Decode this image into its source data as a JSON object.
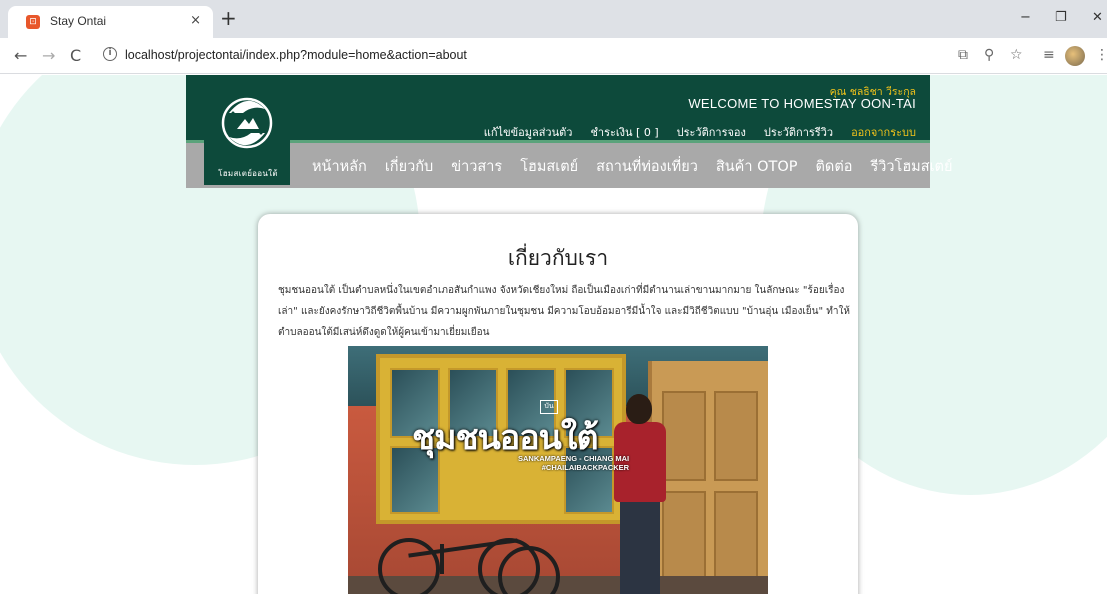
{
  "browser": {
    "tab_title": "Stay Ontai",
    "tab_close": "×",
    "new_tab": "+",
    "url": "localhost/projectontai/index.php?module=home&action=about",
    "window_minimize": "−",
    "window_restore": "❐",
    "window_close": "✕"
  },
  "header": {
    "logo_text": "โฮมสเตย์ออนใต้",
    "user_name": "คุณ ชลธิชา วีระกุล",
    "welcome": "WELCOME TO HOMESTAY OON-TAI",
    "user_links": [
      {
        "label": "แก้ไขข้อมูลส่วนตัว"
      },
      {
        "label": "ชำระเงิน [ 0 ]"
      },
      {
        "label": "ประวัติการจอง"
      },
      {
        "label": "ประวัติการรีวิว"
      },
      {
        "label": "ออกจากระบบ"
      }
    ],
    "nav": [
      {
        "label": "หน้าหลัก"
      },
      {
        "label": "เกี่ยวกับ"
      },
      {
        "label": "ข่าวสาร"
      },
      {
        "label": "โฮมสเตย์"
      },
      {
        "label": "สถานที่ท่องเที่ยว"
      },
      {
        "label": "สินค้า OTOP"
      },
      {
        "label": "ติดต่อ"
      },
      {
        "label": "รีวิวโฮมสเตย์"
      }
    ]
  },
  "content": {
    "title": "เกี่ยวกับเรา",
    "body": "ชุมชนออนใต้ เป็นตำบลหนึ่งในเขตอำเภอสันกำแพง จังหวัดเชียงใหม่ ถือเป็นเมืองเก่าที่มีตำนานเล่าขานมากมาย ในลักษณะ \"ร้อยเรื่องเล่า\" และยังคงรักษาวิถีชีวิตพื้นบ้าน มีความผูกพันภายในชุมชน มีความโอบอ้อมอารีมีน้ำใจ และมีวิถีชีวิตแบบ \"บ้านอุ่น เมืองเย็น\" ทำให้ตำบลออนใต้มีเสน่ห์ดึงดูดให้ผู้คนเข้ามาเยี่ยมเยือน",
    "photo_caption": "ชุมชนออนใต้",
    "photo_subcaption": "SANKAMPAENG - CHIANG MAI",
    "photo_hashtag": "#CHAILAIBACKPACKER",
    "photo_tag": "บัน"
  },
  "colors": {
    "header_bg": "#0d4a3b",
    "nav_bg": "#a9a9a9",
    "accent_yellow": "#f0c21b",
    "bg_circle": "#e7f7f2"
  }
}
